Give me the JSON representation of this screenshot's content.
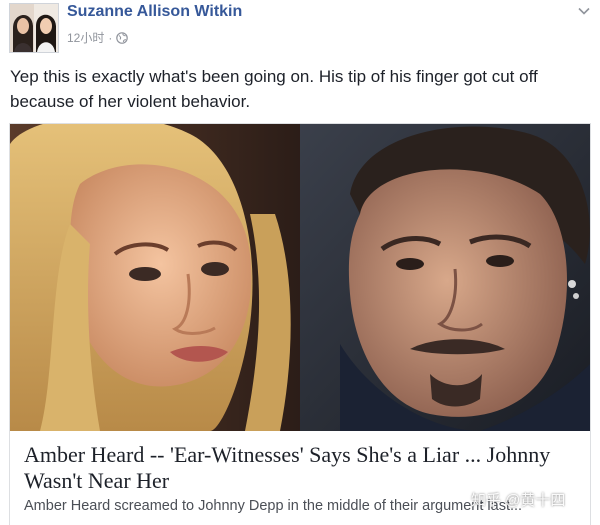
{
  "post": {
    "author": "Suzanne Allison Witkin",
    "timestamp": "12小时",
    "separator": "·",
    "privacy_icon": "globe-icon",
    "options_icon": "chevron-down-icon",
    "text": "Yep this is exactly what's been going on. His tip of his finger got cut off because of her violent behavior."
  },
  "link_card": {
    "title": "Amber Heard -- 'Ear-Witnesses' Says She's a Liar ... Johnny Wasn't Near Her",
    "description": "Amber Heard screamed to Johnny Depp in the middle of their argument last..."
  },
  "watermark": {
    "text": "知乎 @黄十四"
  },
  "colors": {
    "author_link": "#365899",
    "meta_gray": "#90949c",
    "body_text": "#1d2129",
    "card_border": "#dddfe2"
  }
}
